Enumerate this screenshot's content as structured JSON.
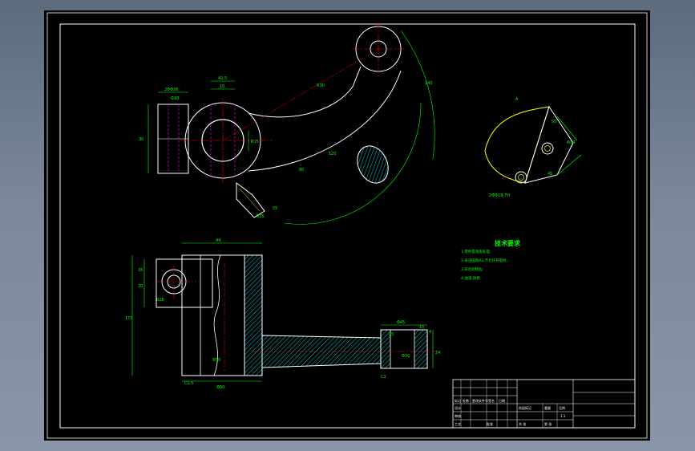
{
  "drawing": {
    "colors": {
      "background": "#000000",
      "outline": "#ffffff",
      "dimension": "#00ff00",
      "centerline": "#ff0000",
      "hidden": "#ff00ff",
      "section_hatch": "#00ffff",
      "border": "#ffffff",
      "highlight": "#ffff00"
    },
    "section_label": "A",
    "tech_requirements": {
      "title": "技术要求",
      "items": [
        "1.零件需调质处理.",
        "2.未注圆角R2,不允许有裂纹,",
        "3.去毛刺锐边.",
        "4.油漆,防锈."
      ]
    },
    "dimensions": {
      "hole_spec_top": "2ΦΦ36",
      "dia_top": "Φ18",
      "width_top": "42.5",
      "small_10": "10",
      "r30": "R30",
      "r35": "R35",
      "dim_30": "30",
      "dim_80": "80",
      "dim_120": "120",
      "dim_55": "55",
      "dim_140": "140",
      "r15": "R15",
      "phi14": "Φ14",
      "dim_50": "50",
      "dim_45": "45",
      "hole_spec_section": "2ΦΦ18-7H",
      "width_44": "44",
      "dim_35": "35",
      "dim_20": "20",
      "dim_170": "170",
      "r26": "R26",
      "phi60": "Φ60",
      "phi50": "Φ50",
      "c15": "C1.5",
      "phi45": "Φ45",
      "dim_15": "15",
      "dim_4": "4",
      "c1": "C1",
      "phi30": "Φ30",
      "dim_24": "24",
      "dim_25": "25"
    },
    "title_block": {
      "labels": [
        "标记",
        "处数",
        "更改文件号",
        "签名",
        "日期",
        "设计",
        "审核",
        "工艺",
        "批准",
        "阶段标记",
        "重量",
        "比例",
        "共 张",
        "第 张"
      ],
      "scale": "1:1"
    }
  }
}
